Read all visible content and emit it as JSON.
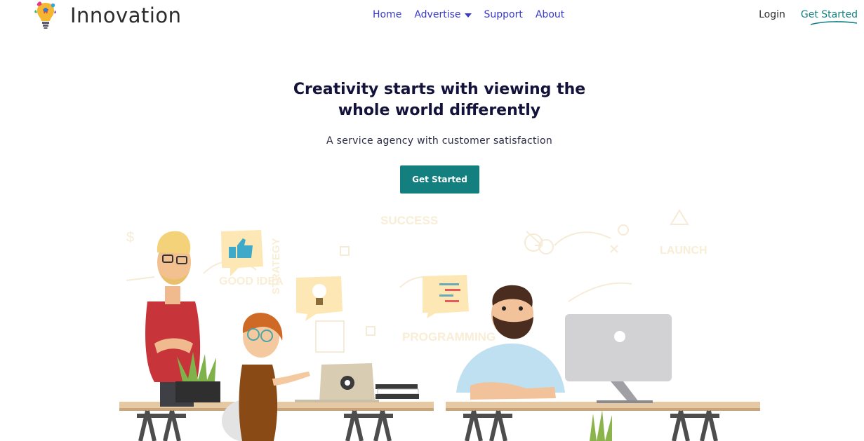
{
  "navbar": {
    "brand_name": "Innovation",
    "links": [
      {
        "label": "Home"
      },
      {
        "label": "Advertise"
      },
      {
        "label": "Support"
      },
      {
        "label": "About"
      }
    ],
    "login_label": "Login",
    "get_started_label": "Get Started"
  },
  "hero": {
    "title_line1": "Creativity starts with viewing the",
    "title_line2": "whole world differently",
    "subtitle": "A service agency with customer satisfaction",
    "cta_label": "Get Started"
  },
  "illustration": {
    "doodle_words": [
      "SUCCESS",
      "GOOD IDEA",
      "STRATEGY",
      "PROGRAMMING",
      "LAUNCH"
    ]
  },
  "colors": {
    "accent": "#137f7f",
    "nav_link": "#3a3ac8",
    "title": "#12123a"
  }
}
